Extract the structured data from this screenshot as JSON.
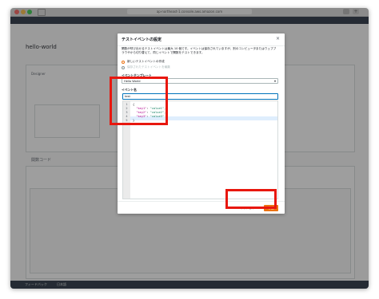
{
  "browser": {
    "url": "ap-northeast-1.console.aws.amazon.com"
  },
  "app": {
    "function_title": "hello-world",
    "section_designer": "Designer",
    "section_code": "関数コード",
    "footer_feedback": "フィードバック",
    "footer_language": "日本語"
  },
  "modal": {
    "title": "テストイベントの設定",
    "close_glyph": "×",
    "description": "関数が呼び出せるテストイベントは最大 10 個です。イベントは保存されていますが、別のコンピュータまたはウェブブラウザから切り替えて、同じイベントで関数をテストできます。",
    "radio_new": "新しいテストイベントの作成",
    "radio_edit": "保存されたテストイベントを編集",
    "template_label": "イベントテンプレート",
    "template_value": "Hello World",
    "caret_glyph": "▾",
    "event_name_label": "イベント名",
    "event_name_value": "test",
    "code_lines": [
      {
        "no": "1",
        "text": "{"
      },
      {
        "no": "2",
        "key": "\"key1\"",
        "value": "\"value1\","
      },
      {
        "no": "3",
        "key": "\"key2\"",
        "value": "\"value2\","
      },
      {
        "no": "4",
        "key": "\"key3\"",
        "value": "\"value3\""
      },
      {
        "no": "5",
        "text": "}"
      }
    ],
    "cancel_label": "キャンセル",
    "create_label": "作成"
  },
  "colors": {
    "accent": "#ec7211",
    "highlight": "#e8170e",
    "focus": "#0073bb"
  }
}
